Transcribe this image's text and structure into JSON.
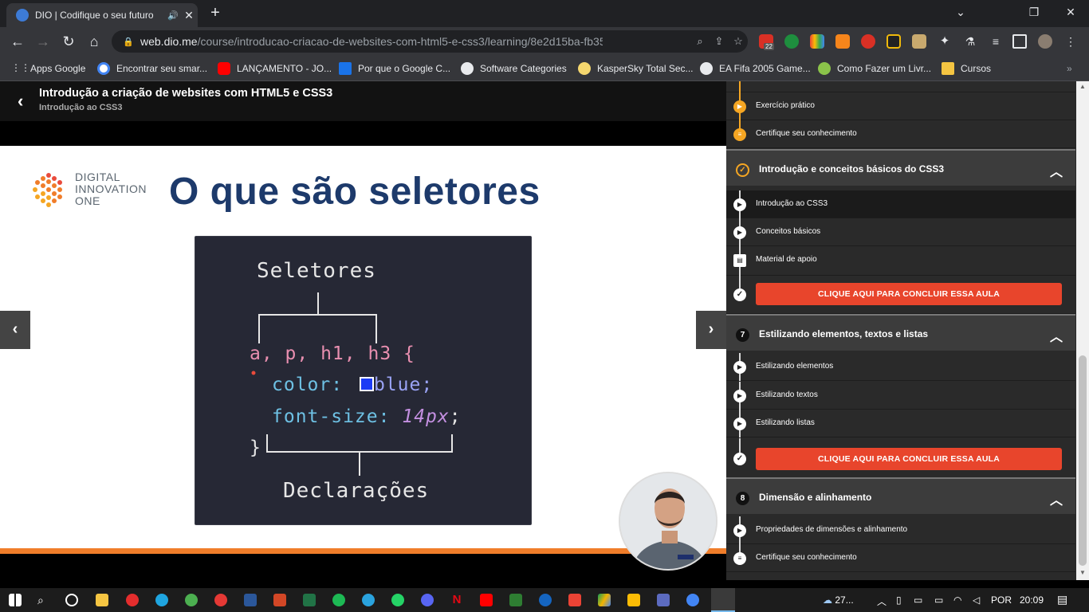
{
  "browser": {
    "tab_title": "DIO | Codifique o seu futuro",
    "tab_close": "✕",
    "new_tab": "+",
    "window_controls": {
      "minimize": "⌄",
      "restore": "❐",
      "close": "✕"
    },
    "url_domain": "web.dio.me",
    "url_path": "/course/introducao-criacao-de-websites-com-html5-e-css3/learning/8e2d15ba-fb35-4a23-aa...",
    "extension_badge": "22",
    "bookmarks": [
      {
        "label": "Apps Google",
        "icon": "apps-grid-icon"
      },
      {
        "label": "Encontrar seu smar...",
        "icon": "google-icon"
      },
      {
        "label": "LANÇAMENTO - JO...",
        "icon": "youtube-icon"
      },
      {
        "label": "Por que o Google C...",
        "icon": "bookmark-icon"
      },
      {
        "label": "Software Categories",
        "icon": "globe-icon"
      },
      {
        "label": "KasperSky Total Sec...",
        "icon": "kaspersky-icon"
      },
      {
        "label": "EA Fifa 2005 Game...",
        "icon": "globe-icon"
      },
      {
        "label": "Como Fazer um Livr...",
        "icon": "book-icon"
      },
      {
        "label": "Cursos",
        "icon": "folder-icon"
      }
    ]
  },
  "course": {
    "title": "Introdução a criação de websites com HTML5 e CSS3",
    "subtitle": "Introdução ao CSS3"
  },
  "slide": {
    "logo_line1": "DIGITAL",
    "logo_line2": "INNOVATION",
    "logo_line3": "ONE",
    "title": "O que são seletores",
    "code_label_top": "Seletores",
    "code_selector": "a, p, h1, h3 {",
    "code_prop1": "color:",
    "code_val1": "blue;",
    "code_prop2": "font-size:",
    "code_val2": "14px",
    "code_semicolon": ";",
    "code_close": "}",
    "code_label_bottom": "Declarações",
    "swatch_color": "#1d3cf5"
  },
  "sidebar": {
    "pre_rows": [
      {
        "label": "Exercício prático",
        "icon": "play-icon"
      },
      {
        "label": "Certifique seu conhecimento",
        "icon": "list-icon"
      }
    ],
    "sections": [
      {
        "number": "",
        "title": "Introdução e conceitos básicos do CSS3",
        "items": [
          {
            "label": "Introdução ao CSS3",
            "active": true
          },
          {
            "label": "Conceitos básicos",
            "active": false
          },
          {
            "label": "Material de apoio",
            "active": false
          }
        ],
        "cta": "CLIQUE AQUI PARA CONCLUIR ESSA AULA"
      },
      {
        "number": "7",
        "title": "Estilizando elementos, textos e listas",
        "items": [
          {
            "label": "Estilizando elementos"
          },
          {
            "label": "Estilizando textos"
          },
          {
            "label": "Estilizando listas"
          }
        ],
        "cta": "CLIQUE AQUI PARA CONCLUIR ESSA AULA"
      },
      {
        "number": "8",
        "title": "Dimensão e alinhamento",
        "items": [
          {
            "label": "Propriedades de dimensões e alinhamento"
          },
          {
            "label": "Certifique seu conhecimento"
          }
        ]
      }
    ]
  },
  "taskbar": {
    "weather": "27...",
    "language": "POR",
    "time": "20:09"
  },
  "colors": {
    "accent_orange": "#f07d2a",
    "cta_red": "#e8452c",
    "slide_title_blue": "#1d3a6b"
  }
}
